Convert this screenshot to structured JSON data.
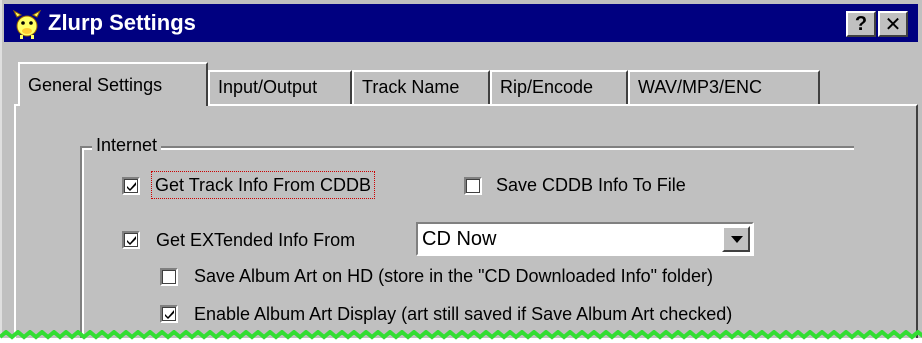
{
  "window": {
    "title": "Zlurp Settings",
    "help_label": "?",
    "close_label": "✕"
  },
  "tabs": [
    {
      "label": "General Settings",
      "active": true
    },
    {
      "label": "Input/Output",
      "active": false
    },
    {
      "label": "Track Name",
      "active": false
    },
    {
      "label": "Rip/Encode",
      "active": false
    },
    {
      "label": "WAV/MP3/ENC",
      "active": false
    }
  ],
  "internet_group": {
    "label": "Internet",
    "get_track_info": {
      "label": "Get Track Info From CDDB",
      "checked": true
    },
    "save_cddb_info": {
      "label": "Save CDDB Info To File",
      "checked": false
    },
    "get_extended_info": {
      "label": "Get EXTended Info From",
      "checked": true
    },
    "extended_source": {
      "value": "CD Now"
    },
    "save_album_art": {
      "label": "Save Album Art on HD (store in the \"CD Downloaded Info\" folder)",
      "checked": false
    },
    "enable_album_art_display": {
      "label": "Enable Album Art Display (art still saved if Save Album Art checked)",
      "checked": true
    }
  },
  "colors": {
    "titlebar": "#000080",
    "face": "#c0c0c0",
    "focus_outline": "#cc0000",
    "torn_edge": "#33dd33"
  },
  "icons": {
    "app": "cow-icon",
    "dropdown": "chevron-down-icon",
    "check": "check-icon"
  }
}
